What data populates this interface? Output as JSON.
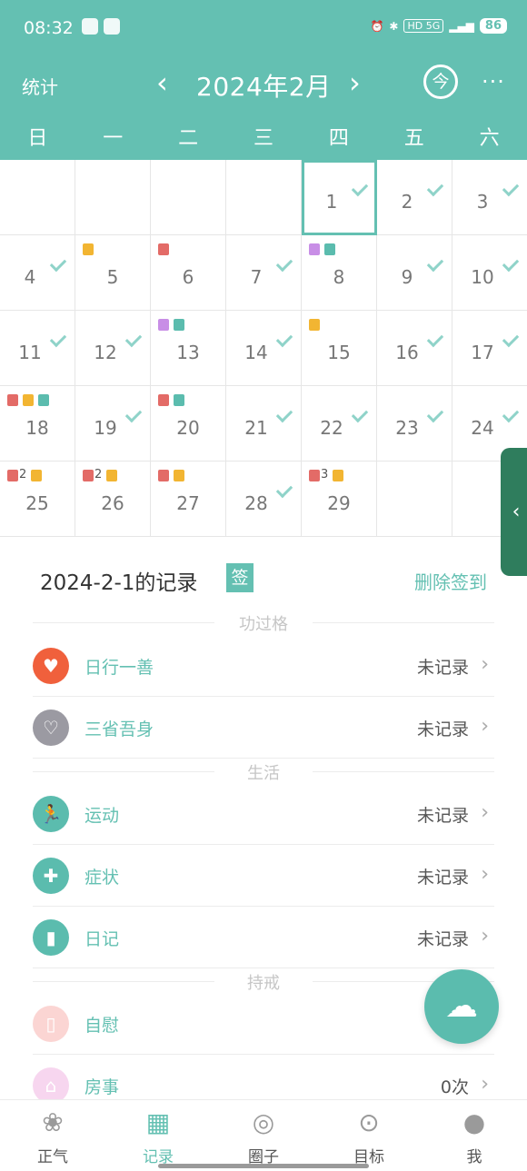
{
  "status_bar": {
    "time": "08:32",
    "right_text": "HD 5G",
    "battery": "86"
  },
  "nav": {
    "stats_label": "统计",
    "prev": "‹",
    "month": "2024年2月",
    "next": "›",
    "today": "今",
    "more": "···"
  },
  "weekdays": [
    "日",
    "一",
    "二",
    "三",
    "四",
    "五",
    "六"
  ],
  "calendar": {
    "selected_day": "1",
    "weeks": [
      [
        {
          "d": ""
        },
        {
          "d": ""
        },
        {
          "d": ""
        },
        {
          "d": ""
        },
        {
          "d": "1",
          "check": true,
          "selected": true
        },
        {
          "d": "2",
          "check": true
        },
        {
          "d": "3",
          "check": true
        }
      ],
      [
        {
          "d": "4",
          "check": true
        },
        {
          "d": "5",
          "marks": [
            "yellow"
          ]
        },
        {
          "d": "6",
          "marks": [
            "red"
          ]
        },
        {
          "d": "7",
          "check": true
        },
        {
          "d": "8",
          "marks": [
            "purple",
            "teal"
          ]
        },
        {
          "d": "9",
          "check": true
        },
        {
          "d": "10",
          "check": true
        }
      ],
      [
        {
          "d": "11",
          "check": true
        },
        {
          "d": "12",
          "check": true
        },
        {
          "d": "13",
          "marks": [
            "purple",
            "teal"
          ]
        },
        {
          "d": "14",
          "check": true
        },
        {
          "d": "15",
          "marks": [
            "yellow"
          ]
        },
        {
          "d": "16",
          "check": true
        },
        {
          "d": "17",
          "check": true
        }
      ],
      [
        {
          "d": "18",
          "marks": [
            "red",
            "yellow",
            "teal"
          ]
        },
        {
          "d": "19",
          "check": true
        },
        {
          "d": "20",
          "marks": [
            "red",
            "teal"
          ]
        },
        {
          "d": "21",
          "check": true
        },
        {
          "d": "22",
          "check": true
        },
        {
          "d": "23",
          "check": true
        },
        {
          "d": "24",
          "check": true
        }
      ],
      [
        {
          "d": "25",
          "marks": [
            "red",
            "yellow"
          ],
          "count": "2"
        },
        {
          "d": "26",
          "marks": [
            "red",
            "yellow"
          ],
          "count": "2"
        },
        {
          "d": "27",
          "marks": [
            "red",
            "yellow"
          ]
        },
        {
          "d": "28",
          "check": true
        },
        {
          "d": "29",
          "marks": [
            "red",
            "yellow"
          ],
          "count": "3"
        },
        {
          "d": ""
        },
        {
          "d": ""
        }
      ]
    ]
  },
  "record": {
    "title": "2024-2-1的记录",
    "sign_badge": "签",
    "delete_label": "删除签到"
  },
  "sections": [
    {
      "label": "功过格",
      "rows": [
        {
          "name": "日行一善",
          "value": "未记录",
          "icon": "heart-icon",
          "color": "#f0603c"
        },
        {
          "name": "三省吾身",
          "value": "未记录",
          "icon": "heart-outline-icon",
          "color": "#9b9aa2"
        }
      ]
    },
    {
      "label": "生活",
      "rows": [
        {
          "name": "运动",
          "value": "未记录",
          "icon": "running-icon",
          "color": "#5bbcae"
        },
        {
          "name": "症状",
          "value": "未记录",
          "icon": "medical-kit-icon",
          "color": "#5bbcae"
        },
        {
          "name": "日记",
          "value": "未记录",
          "icon": "book-icon",
          "color": "#5bbcae"
        }
      ]
    },
    {
      "label": "持戒",
      "rows": [
        {
          "name": "自慰",
          "value": "",
          "icon": "tissue-icon",
          "color": "#fbd5d3"
        },
        {
          "name": "房事",
          "value": "0次",
          "icon": "house-icon",
          "color": "#f7d6ef"
        }
      ]
    }
  ],
  "tabs": [
    {
      "label": "正气",
      "icon": "lotus-icon",
      "active": false
    },
    {
      "label": "记录",
      "icon": "calendar-icon",
      "active": true
    },
    {
      "label": "圈子",
      "icon": "circle-icon",
      "active": false
    },
    {
      "label": "目标",
      "icon": "target-icon",
      "active": false
    },
    {
      "label": "我",
      "icon": "person-icon",
      "active": false
    }
  ],
  "colors": {
    "primary": "#64c0b2",
    "side_handle": "#2f7d5d",
    "mark_red": "#e36b67",
    "mark_yellow": "#f2b532",
    "mark_teal": "#5bbcae",
    "mark_purple": "#c88ee6"
  }
}
